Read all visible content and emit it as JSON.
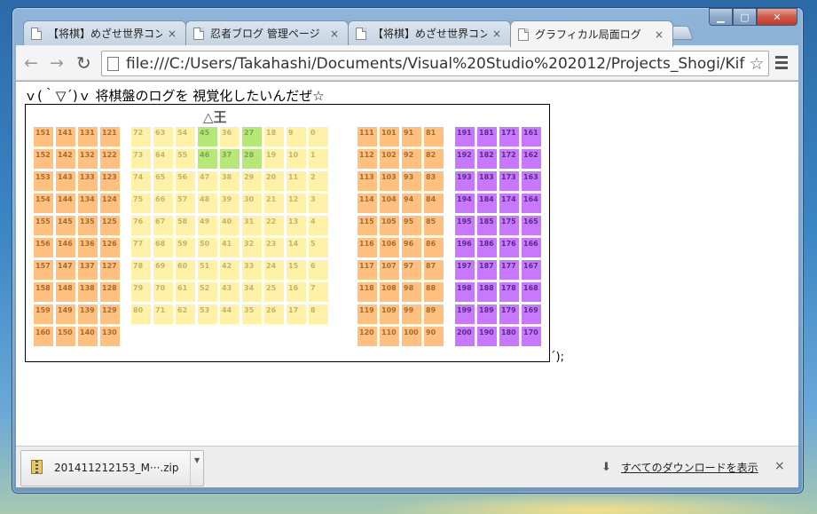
{
  "window": {
    "controls": {
      "minimize": "▁",
      "maximize": "▢",
      "close": "✕"
    }
  },
  "tabs": [
    {
      "title": "【将棋】めざせ世界コンピ",
      "close": "×",
      "active": false
    },
    {
      "title": "忍者ブログ 管理ページ",
      "close": "×",
      "active": false
    },
    {
      "title": "【将棋】めざせ世界コンピ",
      "close": "×",
      "active": false
    },
    {
      "title": "グラフィカル局面ログ",
      "close": "×",
      "active": true
    }
  ],
  "toolbar": {
    "back": "←",
    "forward": "→",
    "reload": "↻",
    "url": "file:///C:/Users/Takahashi/Documents/Visual%20Studio%202012/Projects_Shogi/KifuNarabe",
    "star": "☆"
  },
  "page": {
    "heading": "ｖ(｀▽´)ｖ  将棋盤のログを  視覚化したいんだぜ☆",
    "player_label": "△王",
    "trailing": "´);",
    "colors": {
      "hand": "#ffc080",
      "board": "#fff2a8",
      "king": "#b6e878",
      "gote": "#c878ff"
    },
    "sente_hand": [
      [
        "151",
        "141",
        "131",
        "121"
      ],
      [
        "152",
        "142",
        "132",
        "122"
      ],
      [
        "153",
        "143",
        "133",
        "123"
      ],
      [
        "154",
        "144",
        "134",
        "124"
      ],
      [
        "155",
        "145",
        "135",
        "125"
      ],
      [
        "156",
        "146",
        "136",
        "126"
      ],
      [
        "157",
        "147",
        "137",
        "127"
      ],
      [
        "158",
        "148",
        "138",
        "128"
      ],
      [
        "159",
        "149",
        "139",
        "129"
      ],
      [
        "160",
        "150",
        "140",
        "130"
      ]
    ],
    "board": [
      [
        "72",
        "63",
        "54",
        "45",
        "36",
        "27",
        "18",
        "9",
        "0"
      ],
      [
        "73",
        "64",
        "55",
        "46",
        "37",
        "28",
        "19",
        "10",
        "1"
      ],
      [
        "74",
        "65",
        "56",
        "47",
        "38",
        "29",
        "20",
        "11",
        "2"
      ],
      [
        "75",
        "66",
        "57",
        "48",
        "39",
        "30",
        "21",
        "12",
        "3"
      ],
      [
        "76",
        "67",
        "58",
        "49",
        "40",
        "31",
        "22",
        "13",
        "4"
      ],
      [
        "77",
        "68",
        "59",
        "50",
        "41",
        "32",
        "23",
        "14",
        "5"
      ],
      [
        "78",
        "69",
        "60",
        "51",
        "42",
        "33",
        "24",
        "15",
        "6"
      ],
      [
        "79",
        "70",
        "61",
        "52",
        "43",
        "34",
        "25",
        "16",
        "7"
      ],
      [
        "80",
        "71",
        "62",
        "53",
        "44",
        "35",
        "26",
        "17",
        "8"
      ]
    ],
    "king_cells": [
      "45",
      "27",
      "46",
      "37",
      "28"
    ],
    "gote_hand": [
      [
        "111",
        "101",
        "91",
        "81"
      ],
      [
        "112",
        "102",
        "92",
        "82"
      ],
      [
        "113",
        "103",
        "93",
        "83"
      ],
      [
        "114",
        "104",
        "94",
        "84"
      ],
      [
        "115",
        "105",
        "95",
        "85"
      ],
      [
        "116",
        "106",
        "96",
        "86"
      ],
      [
        "117",
        "107",
        "97",
        "87"
      ],
      [
        "118",
        "108",
        "98",
        "88"
      ],
      [
        "119",
        "109",
        "99",
        "89"
      ],
      [
        "120",
        "110",
        "100",
        "90"
      ]
    ],
    "gote_box": [
      [
        "191",
        "181",
        "171",
        "161"
      ],
      [
        "192",
        "182",
        "172",
        "162"
      ],
      [
        "193",
        "183",
        "173",
        "163"
      ],
      [
        "194",
        "184",
        "174",
        "164"
      ],
      [
        "195",
        "185",
        "175",
        "165"
      ],
      [
        "196",
        "186",
        "176",
        "166"
      ],
      [
        "197",
        "187",
        "177",
        "167"
      ],
      [
        "198",
        "188",
        "178",
        "168"
      ],
      [
        "199",
        "189",
        "179",
        "169"
      ],
      [
        "200",
        "190",
        "180",
        "170"
      ]
    ]
  },
  "downloads": {
    "file_name": "201411212153_M···.zip",
    "menu": "▼",
    "arrow": "⬇",
    "show_all": "すべてのダウンロードを表示",
    "close": "×"
  }
}
